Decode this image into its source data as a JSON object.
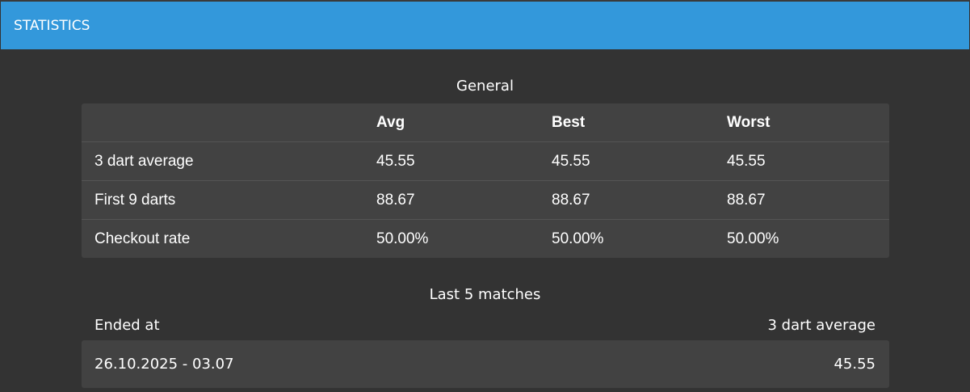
{
  "header": {
    "title": "STATISTICS"
  },
  "general": {
    "title": "General",
    "columns": [
      "",
      "Avg",
      "Best",
      "Worst"
    ],
    "rows": [
      {
        "label": "3 dart average",
        "avg": "45.55",
        "best": "45.55",
        "worst": "45.55"
      },
      {
        "label": "First 9 darts",
        "avg": "88.67",
        "best": "88.67",
        "worst": "88.67"
      },
      {
        "label": "Checkout rate",
        "avg": "50.00%",
        "best": "50.00%",
        "worst": "50.00%"
      }
    ]
  },
  "matches": {
    "title": "Last 5 matches",
    "col_ended": "Ended at",
    "col_average": "3 dart average",
    "items": [
      {
        "ended_at": "26.10.2025 - 03.07",
        "average": "45.55"
      }
    ]
  },
  "colors": {
    "header_bg": "#3398db",
    "page_bg": "#333333",
    "panel_bg": "#424242"
  }
}
